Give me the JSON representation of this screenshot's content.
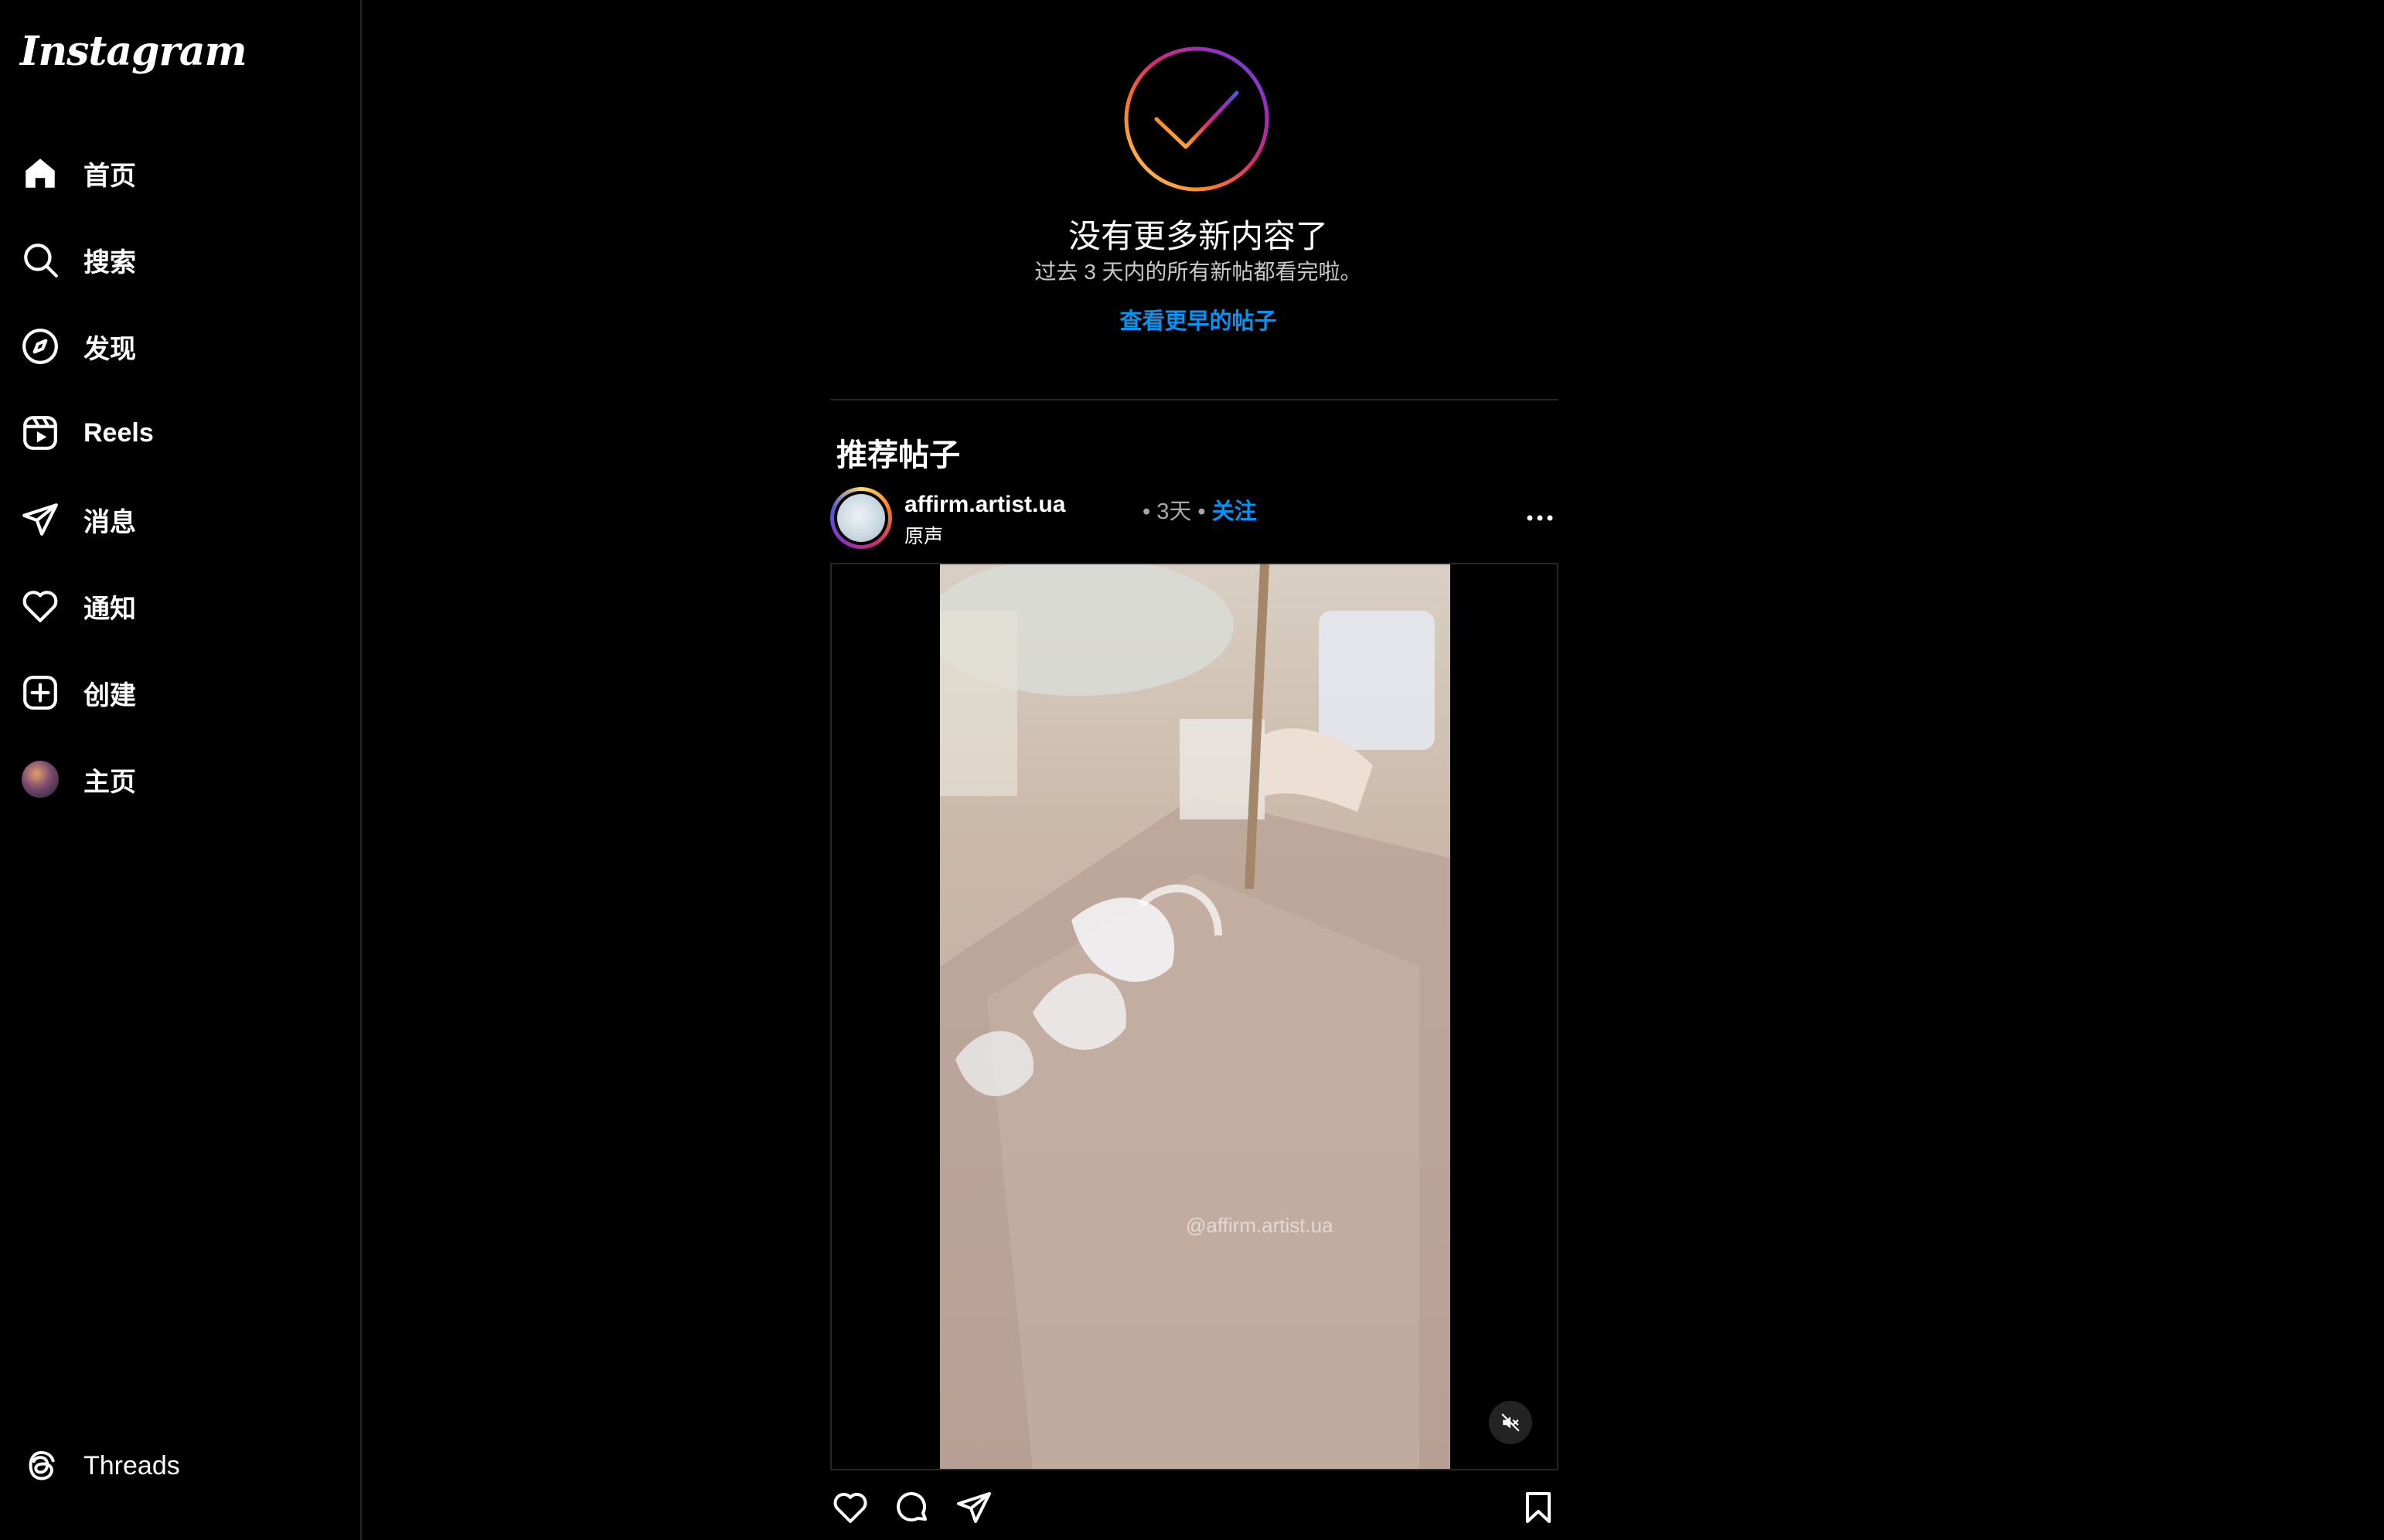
{
  "sidebar": {
    "logo": "Instagram",
    "items": [
      {
        "label": "首页",
        "icon": "home-icon"
      },
      {
        "label": "搜索",
        "icon": "search-icon"
      },
      {
        "label": "发现",
        "icon": "compass-icon"
      },
      {
        "label": "Reels",
        "icon": "reels-icon"
      },
      {
        "label": "消息",
        "icon": "paper-plane-icon"
      },
      {
        "label": "通知",
        "icon": "heart-icon"
      },
      {
        "label": "创建",
        "icon": "plus-square-icon"
      },
      {
        "label": "主页",
        "icon": "avatar"
      }
    ],
    "threads_label": "Threads"
  },
  "caught_up": {
    "title": "没有更多新内容了",
    "subtitle": "过去 3 天内的所有新帖都看完啦。",
    "link": "查看更早的帖子"
  },
  "suggested": {
    "title": "推荐帖子"
  },
  "post": {
    "username": "affirm.artist.ua",
    "separator": "•",
    "time": "3天",
    "follow": "关注",
    "audio": "原声",
    "watermark": "@affirm.artist.ua"
  },
  "colors": {
    "background": "#000000",
    "link_blue": "#0095f6",
    "divider": "#262626"
  }
}
